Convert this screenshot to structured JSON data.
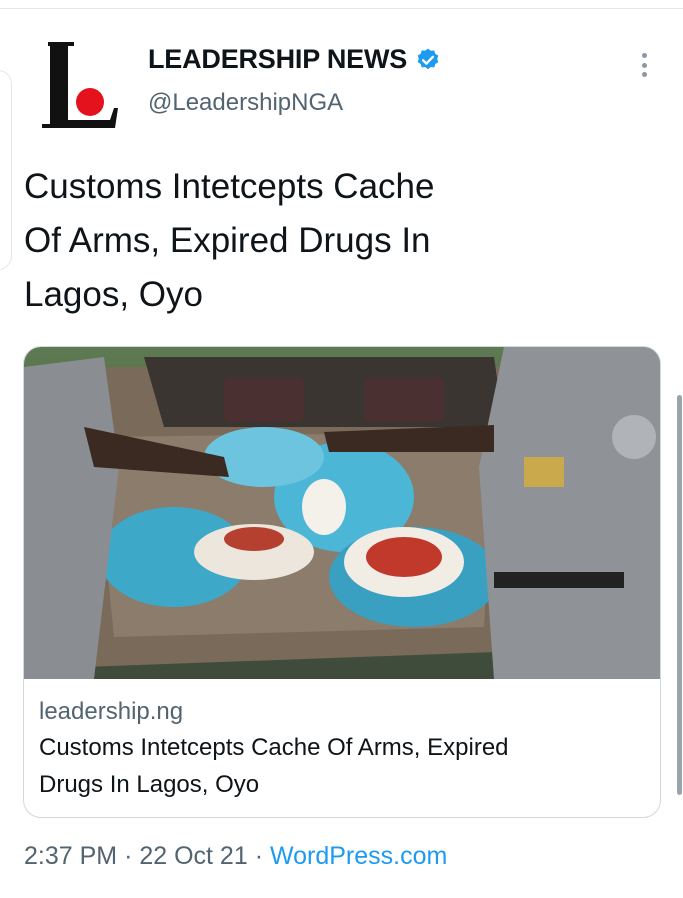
{
  "tweet": {
    "display_name": "LEADERSHIP NEWS",
    "handle": "@LeadershipNGA",
    "verified_icon": "verified-badge-icon",
    "more_icon": "more-options-icon",
    "avatar_logo_letter": "L",
    "text_lines": [
      "Customs Intetcepts Cache",
      "Of Arms, Expired Drugs In",
      "Lagos, Oyo"
    ],
    "time": "2:37 PM",
    "date": "22 Oct 21",
    "source": "WordPress.com",
    "separator": "·"
  },
  "link_card": {
    "domain": "leadership.ng",
    "title_lines": [
      "Customs Intetcepts Cache Of Arms, Expired",
      "Drugs In Lagos, Oyo"
    ],
    "image_icon": "photo-of-seized-goods-in-car-boot"
  },
  "colors": {
    "brand_red": "#e3121c",
    "verified_blue": "#1d9bf0",
    "link_blue": "#1d9bf0",
    "secondary_text": "#536471"
  }
}
